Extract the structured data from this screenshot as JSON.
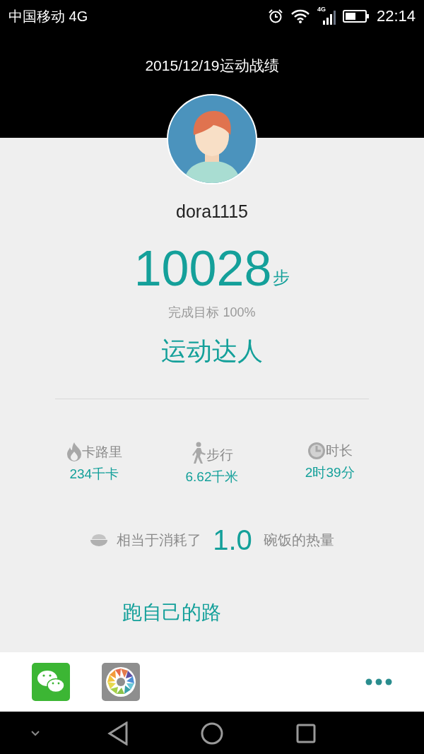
{
  "status_bar": {
    "carrier": "中国移动 4G",
    "network": "4G",
    "time": "22:14"
  },
  "header": {
    "title": "2015/12/19运动战绩"
  },
  "profile": {
    "username": "dora1115"
  },
  "steps": {
    "count": "10028",
    "unit": "步",
    "goal": "完成目标 100%",
    "rank": "运动达人"
  },
  "stats": [
    {
      "kind": "calories",
      "label": "卡路里",
      "value": "234千卡"
    },
    {
      "kind": "distance",
      "label": "步行",
      "value": "6.62千米"
    },
    {
      "kind": "duration",
      "label": "时长",
      "value": "2时39分"
    }
  ],
  "rice": {
    "prefix": "相当于消耗了",
    "amount": "1.0",
    "suffix": "碗饭的热量"
  },
  "slogan": "跑自己的路",
  "share_bar": {
    "apps": [
      {
        "kind": "chat"
      },
      {
        "kind": "camera"
      }
    ]
  }
}
